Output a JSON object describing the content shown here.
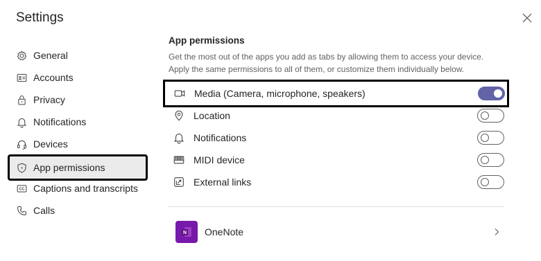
{
  "window": {
    "title": "Settings"
  },
  "sidebar": {
    "items": [
      {
        "label": "General",
        "icon": "gear-icon"
      },
      {
        "label": "Accounts",
        "icon": "id-card-icon"
      },
      {
        "label": "Privacy",
        "icon": "lock-icon"
      },
      {
        "label": "Notifications",
        "icon": "bell-icon"
      },
      {
        "label": "Devices",
        "icon": "headset-icon"
      },
      {
        "label": "App permissions",
        "icon": "shield-icon",
        "active": true
      },
      {
        "label": "Captions and transcripts",
        "icon": "cc-icon"
      },
      {
        "label": "Calls",
        "icon": "phone-icon"
      }
    ]
  },
  "main": {
    "title": "App permissions",
    "description": "Get the most out of the apps you add as tabs by allowing them to access your device. Apply the same permissions to all of them, or customize them individually below.",
    "permissions": [
      {
        "label": "Media (Camera, microphone, speakers)",
        "icon": "camera-icon",
        "enabled": true
      },
      {
        "label": "Location",
        "icon": "location-pin-icon",
        "enabled": false
      },
      {
        "label": "Notifications",
        "icon": "bell-icon",
        "enabled": false
      },
      {
        "label": "MIDI device",
        "icon": "keyboard-icon",
        "enabled": false
      },
      {
        "label": "External links",
        "icon": "external-link-icon",
        "enabled": false
      }
    ],
    "apps": [
      {
        "name": "OneNote",
        "icon": "onenote-icon",
        "color": "#7719aa"
      }
    ]
  },
  "colors": {
    "accent": "#6264a7",
    "active_nav_bg": "#ebebeb",
    "highlight_border": "#000000"
  }
}
